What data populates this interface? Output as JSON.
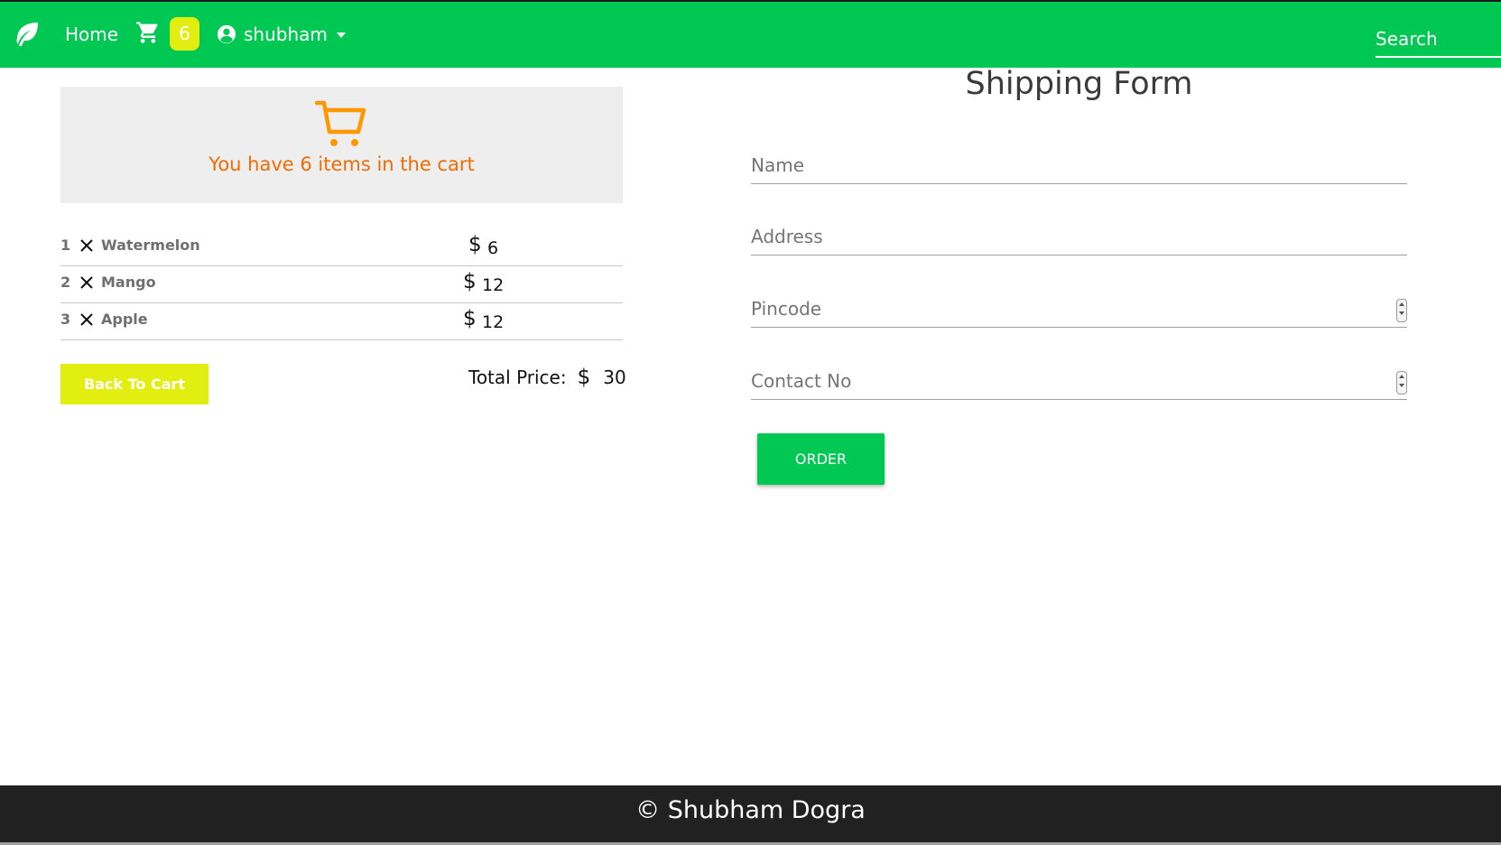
{
  "navbar": {
    "brand_icon": "leaf-icon",
    "home_label": "Home",
    "cart_icon": "shopping-cart-icon",
    "cart_count": "6",
    "user_icon": "account-circle-icon",
    "user_name": "shubham",
    "search_placeholder": "Search",
    "colors": {
      "bar": "#00c853",
      "badge": "#e1ee10"
    }
  },
  "cart_summary": {
    "icon": "shopping-cart-outline-icon",
    "message": "You have 6 items in the cart",
    "items": [
      {
        "qty": "1",
        "name": "Watermelon",
        "currency": "$",
        "price": "6"
      },
      {
        "qty": "2",
        "name": "Mango",
        "currency": "$",
        "price": "12"
      },
      {
        "qty": "3",
        "name": "Apple",
        "currency": "$",
        "price": "12"
      }
    ],
    "back_button_label": "Back To Cart",
    "total_label": "Total Price:",
    "total_currency": "$",
    "total_value": "30",
    "colors": {
      "message": "#ef6c00",
      "card": "#eeeeee",
      "back_button": "#e1ee10"
    }
  },
  "shipping_form": {
    "title": "Shipping Form",
    "fields": {
      "name_placeholder": "Name",
      "address_placeholder": "Address",
      "pincode_placeholder": "Pincode",
      "contact_placeholder": "Contact No"
    },
    "order_button_label": "ORDER"
  },
  "footer": {
    "text": "© Shubham Dogra"
  }
}
